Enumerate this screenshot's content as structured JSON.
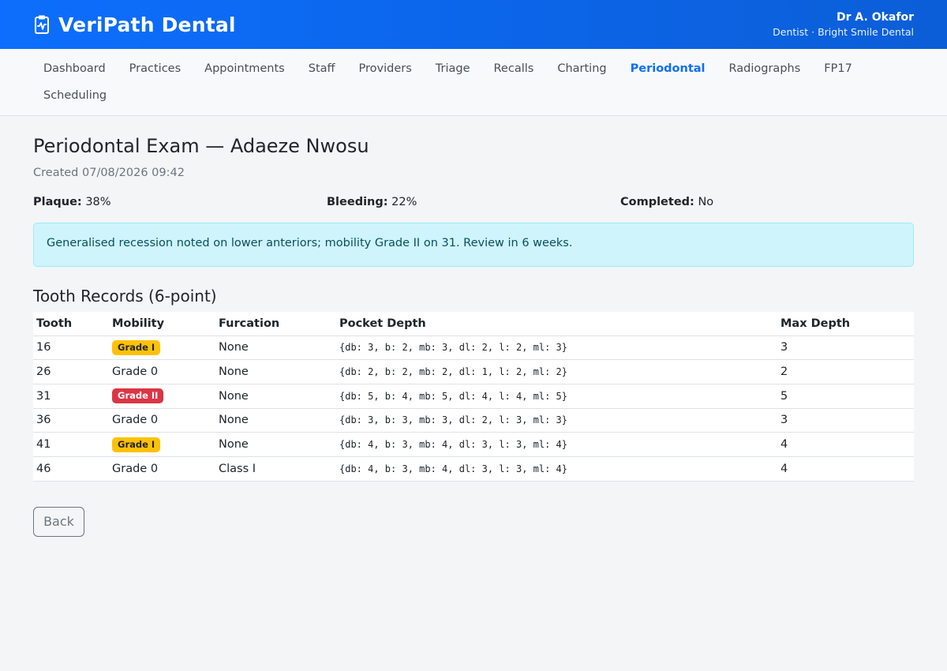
{
  "header": {
    "brand": "VeriPath Dental",
    "brand_icon": "clipboard-pulse-icon",
    "user_name": "Dr A. Okafor",
    "user_role": "Dentist · Bright Smile Dental",
    "accent_color": "#0d6efd"
  },
  "nav": {
    "items": [
      {
        "label": "Dashboard"
      },
      {
        "label": "Practices"
      },
      {
        "label": "Appointments"
      },
      {
        "label": "Staff"
      },
      {
        "label": "Providers"
      },
      {
        "label": "Triage"
      },
      {
        "label": "Recalls"
      },
      {
        "label": "Charting"
      },
      {
        "label": "Periodontal",
        "active": true
      },
      {
        "label": "Radiographs"
      },
      {
        "label": "FP17"
      },
      {
        "label": "Scheduling"
      }
    ]
  },
  "exam": {
    "title": "Periodontal Exam — Adaeze Nwosu",
    "created": "Created 07/08/2026 09:42",
    "plaque_label": "Plaque:",
    "plaque_value": "38%",
    "bleeding_label": "Bleeding:",
    "bleeding_value": "22%",
    "completed_label": "Completed:",
    "completed_value": "No",
    "note": "Generalised recession noted on lower anteriors; mobility Grade II on 31. Review in 6 weeks."
  },
  "records": {
    "title": "Tooth Records (6-point)",
    "columns": [
      "Tooth",
      "Mobility",
      "Furcation",
      "Pocket Depth",
      "Max Depth"
    ],
    "rows": [
      {
        "tooth": "16",
        "mobility": "Grade I",
        "mobility_style": "warn",
        "furcation": "None",
        "pocket": "{db: 3, b: 2, mb: 3, dl: 2, l: 2, ml: 3}",
        "max": "3"
      },
      {
        "tooth": "26",
        "mobility": "Grade 0",
        "mobility_style": "plain",
        "furcation": "None",
        "pocket": "{db: 2, b: 2, mb: 2, dl: 1, l: 2, ml: 2}",
        "max": "2"
      },
      {
        "tooth": "31",
        "mobility": "Grade II",
        "mobility_style": "danger",
        "furcation": "None",
        "pocket": "{db: 5, b: 4, mb: 5, dl: 4, l: 4, ml: 5}",
        "max": "5"
      },
      {
        "tooth": "36",
        "mobility": "Grade 0",
        "mobility_style": "plain",
        "furcation": "None",
        "pocket": "{db: 3, b: 3, mb: 3, dl: 2, l: 3, ml: 3}",
        "max": "3"
      },
      {
        "tooth": "41",
        "mobility": "Grade I",
        "mobility_style": "warn",
        "furcation": "None",
        "pocket": "{db: 4, b: 3, mb: 4, dl: 3, l: 3, ml: 4}",
        "max": "4"
      },
      {
        "tooth": "46",
        "mobility": "Grade 0",
        "mobility_style": "plain",
        "furcation": "Class I",
        "pocket": "{db: 4, b: 3, mb: 4, dl: 3, l: 3, ml: 4}",
        "max": "4"
      }
    ]
  },
  "actions": {
    "back_label": "Back"
  }
}
